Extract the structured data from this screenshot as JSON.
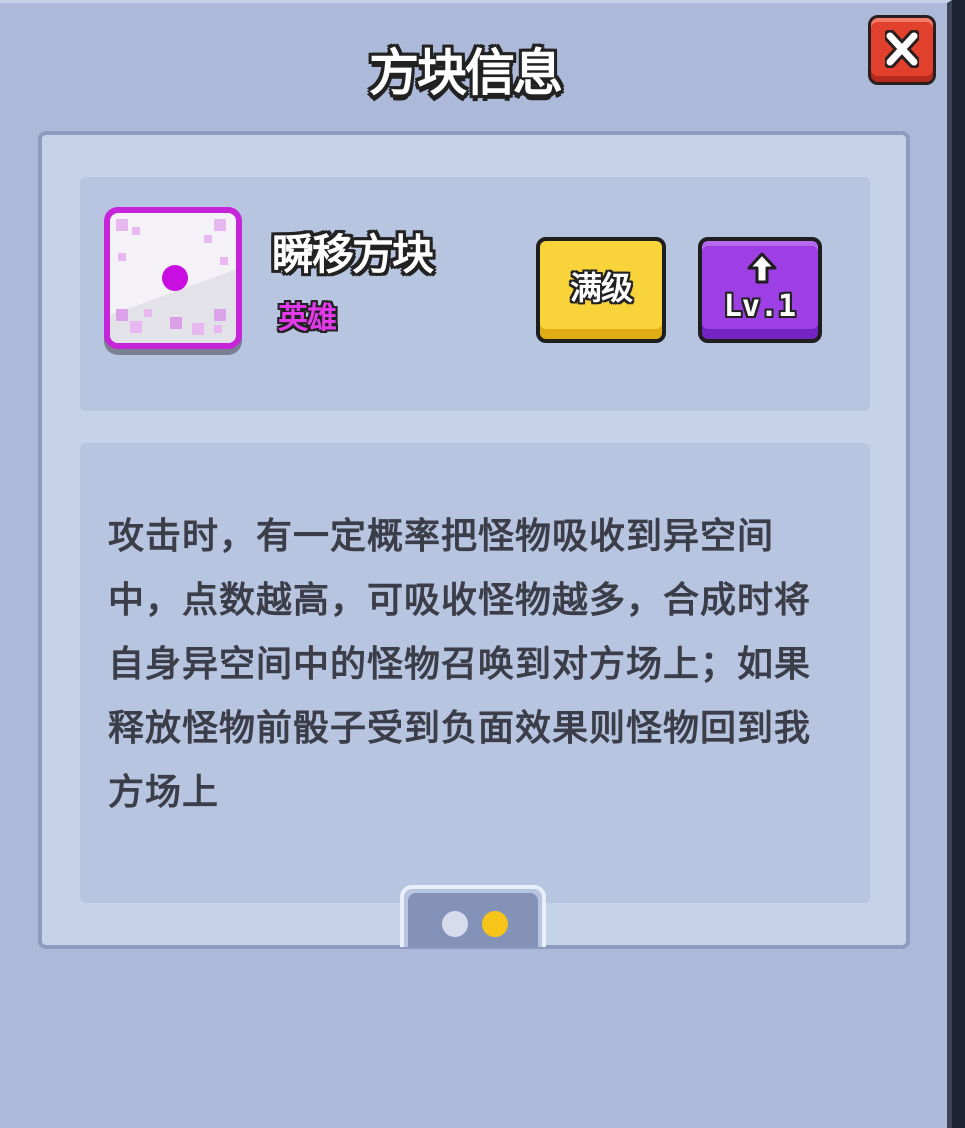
{
  "dialog": {
    "title": "方块信息",
    "close_icon": "close-x-icon"
  },
  "block": {
    "name": "瞬移方块",
    "rarity": "英雄",
    "icon": "teleport-dice-icon",
    "colors": {
      "rarity": "#e23aea",
      "frame": "#c624d9"
    }
  },
  "buttons": {
    "max_level_label": "满级",
    "upgrade_icon": "arrow-up-icon",
    "upgrade_level_label": "Lv.1"
  },
  "description": "攻击时，有一定概率把怪物吸收到异空间中，点数越高，可吸收怪物越多，合成时将自身异空间中的怪物召唤到对方场上；如果释放怪物前骰子受到负面效果则怪物回到我方场上",
  "pager": {
    "pages": 2,
    "active_page": 2,
    "colors": {
      "active": "#f7c519",
      "inactive": "#d6dcec"
    }
  }
}
